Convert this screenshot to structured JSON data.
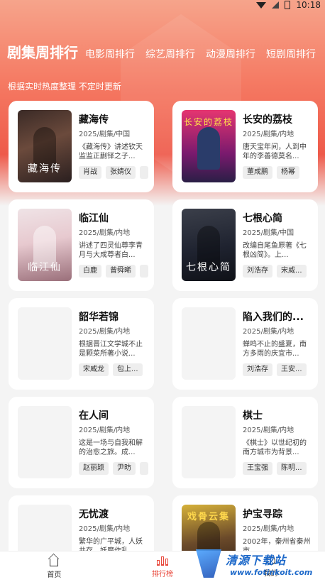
{
  "status_bar": {
    "time": "10:18"
  },
  "tabs": [
    {
      "label": "剧集周排行",
      "active": true
    },
    {
      "label": "电影周排行",
      "active": false
    },
    {
      "label": "综艺周排行",
      "active": false
    },
    {
      "label": "动漫周排行",
      "active": false
    },
    {
      "label": "短剧周排行",
      "active": false
    }
  ],
  "subtitle": "根据实时热度整理 不定时更新",
  "cards": [
    {
      "title": "藏海传",
      "meta": "2025/剧集/中国",
      "desc": "《藏海传》讲述钦天监监正蒯铎之子...",
      "chips": [
        "肖战",
        "张婧仪",
        ""
      ],
      "poster_text": "藏海传"
    },
    {
      "title": "长安的荔枝",
      "meta": "2025/剧集/内地",
      "desc": "唐天宝年间，人到中年的李善德莫名...",
      "chips": [
        "董成鹏",
        "杨幂"
      ],
      "poster_text": "长安的荔枝"
    },
    {
      "title": "临江仙",
      "meta": "2025/剧集/内地",
      "desc": "讲述了四灵仙尊李青月与大成尊者白...",
      "chips": [
        "白鹿",
        "曾舜晞",
        ""
      ],
      "poster_text": "临江仙"
    },
    {
      "title": "七根心简",
      "meta": "2025/剧集/中国",
      "desc": "改编自尾鱼原著《七根凶简》。上...",
      "chips": [
        "刘浩存",
        "宋威..."
      ],
      "poster_text": "七根心简"
    },
    {
      "title": "韶华若锦",
      "meta": "2025/剧集/内地",
      "desc": "根据晋江文学城不止是颗菜所著小说...",
      "chips": [
        "宋威龙",
        "包上..."
      ],
      "poster_text": ""
    },
    {
      "title": "陷入我们的...",
      "meta": "2025/剧集/内地",
      "desc": "蝉鸣不止的盛夏，南方多雨的庆宜市...",
      "chips": [
        "刘浩存",
        "王安..."
      ],
      "poster_text": ""
    },
    {
      "title": "在人间",
      "meta": "2025/剧集/内地",
      "desc": "这是一场与自我和解的治愈之旅。成...",
      "chips": [
        "赵丽颖",
        "尹昉",
        ""
      ],
      "poster_text": ""
    },
    {
      "title": "棋士",
      "meta": "2025/剧集/内地",
      "desc": "《棋士》以世纪初的南方城市为背景...",
      "chips": [
        "王宝强",
        "陈明..."
      ],
      "poster_text": ""
    },
    {
      "title": "无忧渡",
      "meta": "2025/剧集/内地",
      "desc": "繁华的广平城，人妖共存，妖魔作乱...",
      "chips": [],
      "poster_text": ""
    },
    {
      "title": "护宝寻踪",
      "meta": "2025/剧集/内地",
      "desc": "2002年，秦州省秦州市...",
      "chips": [],
      "poster_text": "戏骨云集"
    }
  ],
  "bottom_nav": [
    {
      "label": "首页",
      "icon": "home-icon",
      "active": false
    },
    {
      "label": "排行榜",
      "icon": "ranking-icon",
      "active": true
    },
    {
      "label": "我的",
      "icon": "profile-icon",
      "active": false
    }
  ],
  "watermark": {
    "text": "清源下载站",
    "url": "www.fotinkoit.com"
  },
  "colors": {
    "accent": "#e8473a",
    "hero_top": "#f6a48b",
    "hero_mid": "#ee5a4a"
  }
}
